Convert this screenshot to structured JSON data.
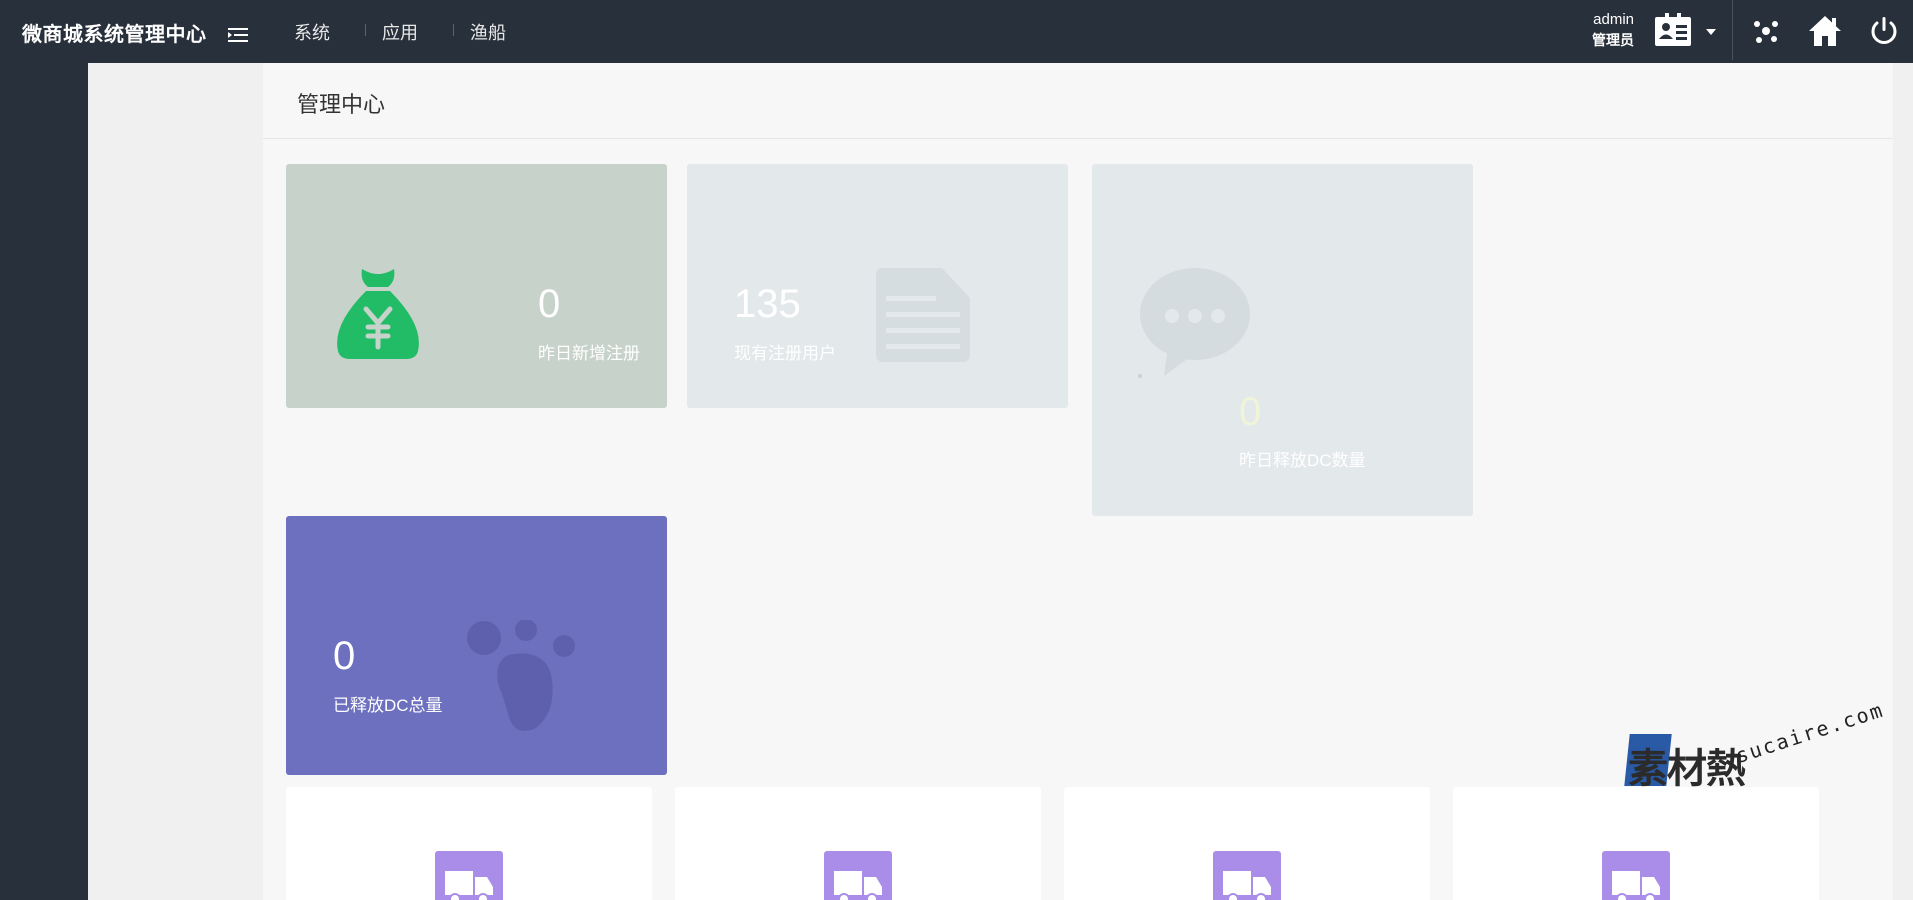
{
  "header": {
    "brand": "微商城系统管理中心",
    "nav": [
      {
        "label": "系统"
      },
      {
        "label": "应用"
      },
      {
        "label": "渔船"
      }
    ],
    "user": {
      "name": "admin",
      "role": "管理员"
    }
  },
  "page": {
    "title": "管理中心"
  },
  "stats": [
    {
      "value": "0",
      "label": "昨日新增注册",
      "icon": "money-bag-icon",
      "color": "#c7d2cb"
    },
    {
      "value": "135",
      "label": "现有注册用户",
      "icon": "document-icon",
      "color": "#e3e8ea"
    },
    {
      "value": "0",
      "label": "昨日释放DC数量",
      "icon": "chat-bubble-icon",
      "color": "#e3e8ea"
    },
    {
      "value": "0",
      "label": "已释放DC总量",
      "icon": "paw-icon",
      "color": "#6d6fbf"
    }
  ],
  "tiles": [
    {
      "icon": "truck-icon"
    },
    {
      "icon": "truck-icon"
    },
    {
      "icon": "truck-icon"
    },
    {
      "icon": "truck-icon"
    }
  ],
  "watermark": {
    "cn": "素材熱",
    "en": "sucaire.com"
  },
  "colors": {
    "topbar": "#28303b",
    "accent_green": "#22bb66",
    "purple": "#6d6fbf",
    "truck": "#a98de8"
  }
}
